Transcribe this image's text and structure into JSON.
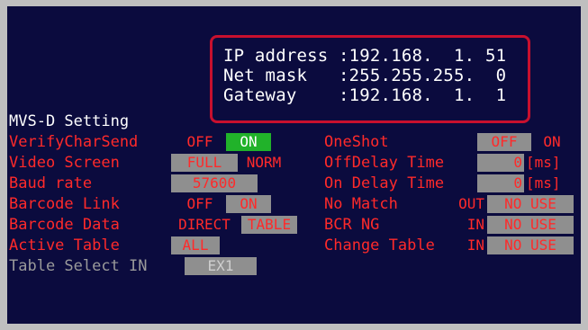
{
  "network": {
    "ip_label": "IP address",
    "ip_value": ":192.168.  1. 51",
    "mask_label": "Net mask",
    "mask_value": ":255.255.255.  0",
    "gw_label": "Gateway",
    "gw_value": ":192.168.  1.  1"
  },
  "title": "MVS-D Setting",
  "left": {
    "verify": {
      "label": "VerifyCharSend",
      "off": "OFF",
      "on": "ON"
    },
    "video": {
      "label": "Video Screen",
      "full": "FULL",
      "norm": "NORM"
    },
    "baud": {
      "label": "Baud rate",
      "value": "57600"
    },
    "barcode_link": {
      "label": "Barcode Link",
      "off": "OFF",
      "on": "ON"
    },
    "barcode_data": {
      "label": "Barcode Data",
      "direct": "DIRECT",
      "table": "TABLE"
    },
    "active_table": {
      "label": "Active Table",
      "value": "ALL"
    },
    "table_select": {
      "label": "Table Select IN",
      "value": "EX1"
    }
  },
  "right": {
    "oneshot": {
      "label": "OneShot",
      "off": "OFF",
      "on": "ON"
    },
    "offdelay": {
      "label": "OffDelay Time",
      "value": "0",
      "unit": "[ms]"
    },
    "ondelay": {
      "label": "On Delay Time",
      "value": "0",
      "unit": "[ms]"
    },
    "nomatch": {
      "label": "No Match",
      "port": "OUT",
      "value": "NO USE"
    },
    "bcrng": {
      "label": "BCR NG",
      "port": "IN",
      "value": "NO USE"
    },
    "change_table": {
      "label": "Change Table",
      "port": "IN",
      "value": "NO USE"
    }
  },
  "colors": {
    "screen_bg": "#0b0b3e",
    "label_red": "#ff2a2a",
    "selected_green": "#21b22a",
    "unselected_gray": "#8f8f8f",
    "highlight_border": "#c8102e"
  }
}
